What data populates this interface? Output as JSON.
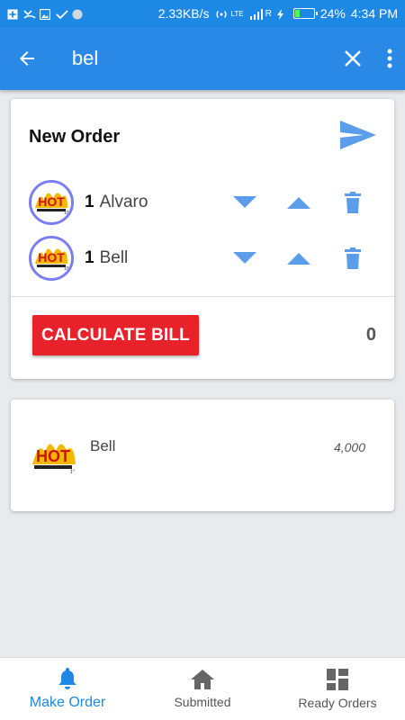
{
  "status_bar": {
    "speed": "2.33KB/s",
    "network": "LTE",
    "roaming": "R",
    "battery_percent": "24%",
    "battery_level": 0.24,
    "time": "4:34 PM"
  },
  "app_bar": {
    "search_value": "bel",
    "back_icon": "arrow-back-icon",
    "clear_icon": "close-icon",
    "more_icon": "more-vertical-icon"
  },
  "order_card": {
    "title": "New Order",
    "send_icon": "send-icon",
    "items": [
      {
        "qty": "1",
        "name": "Alvaro"
      },
      {
        "qty": "1",
        "name": "Bell"
      }
    ],
    "calculate_label": "CALCULATE BILL",
    "total": "0"
  },
  "product_list": [
    {
      "name": "Bell",
      "price": "4,000"
    }
  ],
  "bottom_nav": {
    "items": [
      {
        "label": "Make Order",
        "icon": "bell-icon",
        "active": true
      },
      {
        "label": "Submitted",
        "icon": "home-icon",
        "active": false
      },
      {
        "label": "Ready Orders",
        "icon": "dashboard-icon",
        "active": false
      }
    ]
  },
  "colors": {
    "primary": "#2a89e6",
    "accent_red": "#e8222b",
    "control_blue": "#5b9de8",
    "avatar_border": "#7b7ef0"
  }
}
